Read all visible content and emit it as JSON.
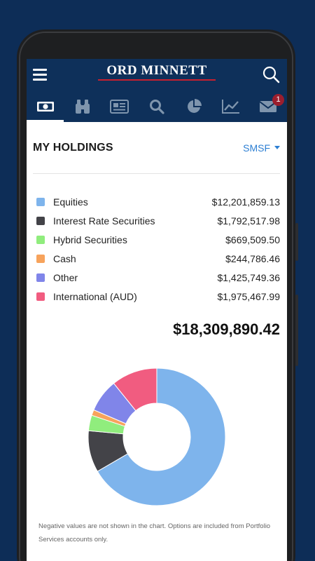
{
  "app": {
    "logo_text": "ORD MINNETT"
  },
  "tabs": [
    {
      "icon": "banknote-icon",
      "active": true
    },
    {
      "icon": "binoculars-icon",
      "active": false
    },
    {
      "icon": "newspaper-icon",
      "active": false
    },
    {
      "icon": "search-icon",
      "active": false
    },
    {
      "icon": "pie-chart-icon",
      "active": false
    },
    {
      "icon": "line-chart-icon",
      "active": false
    },
    {
      "icon": "mail-icon",
      "active": false,
      "badge": "1"
    }
  ],
  "holdings": {
    "title": "MY HOLDINGS",
    "account": "SMSF",
    "items": [
      {
        "name": "Equities",
        "value": "$12,201,859.13",
        "color": "#7eb4ec"
      },
      {
        "name": "Interest Rate Securities",
        "value": "$1,792,517.98",
        "color": "#434348"
      },
      {
        "name": "Hybrid Securities",
        "value": "$669,509.50",
        "color": "#90ed7d"
      },
      {
        "name": "Cash",
        "value": "$244,786.46",
        "color": "#f7a35c"
      },
      {
        "name": "Other",
        "value": "$1,425,749.36",
        "color": "#8085e9"
      },
      {
        "name": "International (AUD)",
        "value": "$1,975,467.99",
        "color": "#f15c80"
      }
    ],
    "total": "$18,309,890.42"
  },
  "chart_data": {
    "type": "pie",
    "style": "donut",
    "categories": [
      "Equities",
      "Interest Rate Securities",
      "Hybrid Securities",
      "Cash",
      "Other",
      "International (AUD)"
    ],
    "values": [
      12201859.13,
      1792517.98,
      669509.5,
      244786.46,
      1425749.36,
      1975467.99
    ],
    "colors": [
      "#7eb4ec",
      "#434348",
      "#90ed7d",
      "#f7a35c",
      "#8085e9",
      "#f15c80"
    ],
    "legend": "none"
  },
  "note": "Negative values are not shown in the chart. Options are included from Portfolio Services accounts only."
}
